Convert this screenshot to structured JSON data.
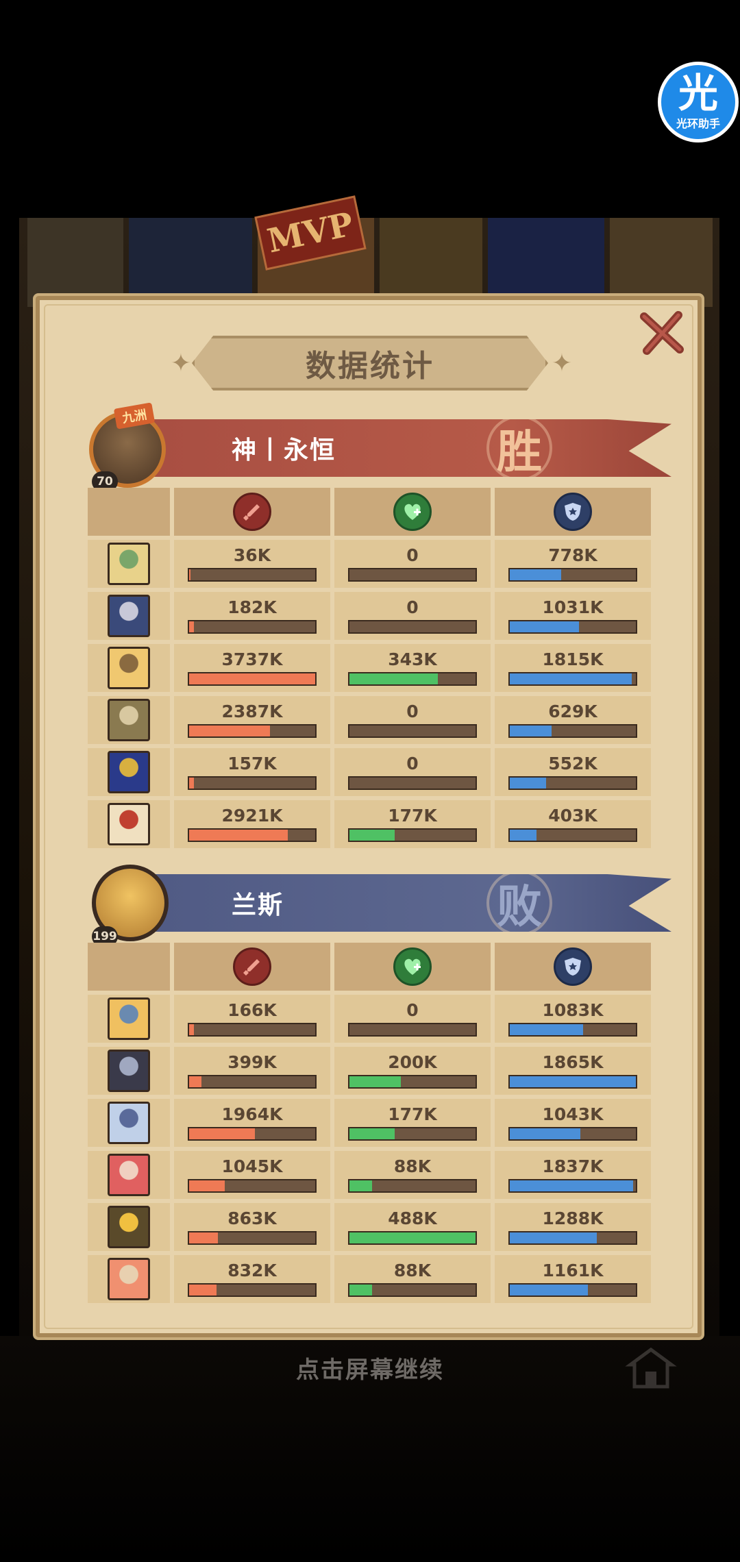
{
  "badge": {
    "glyph": "光",
    "label": "光环助手"
  },
  "mvp_label": "MVP",
  "panel": {
    "title": "数据统计",
    "close_glyph": "✕"
  },
  "footer": {
    "tap_to_continue": "点击屏幕继续"
  },
  "colors": {
    "damage_bar": "#ef7a55",
    "heal_bar": "#4fc164",
    "tank_bar": "#4b8fd8",
    "win_banner": "#a84e42",
    "lose_banner": "#505a84"
  },
  "teams": [
    {
      "name": "神丨永恒",
      "result": "胜",
      "level": "70",
      "rank_tag": "九洲",
      "columns": [
        "damage-icon",
        "heal-icon",
        "shield-icon"
      ],
      "heroes": [
        {
          "dmg": "36K",
          "dmg_pct": 0.01,
          "heal": "0",
          "heal_pct": 0,
          "tank": "778K",
          "tank_pct": 0.41
        },
        {
          "dmg": "182K",
          "dmg_pct": 0.04,
          "heal": "0",
          "heal_pct": 0,
          "tank": "1031K",
          "tank_pct": 0.55
        },
        {
          "dmg": "3737K",
          "dmg_pct": 1.0,
          "heal": "343K",
          "heal_pct": 0.7,
          "tank": "1815K",
          "tank_pct": 0.97
        },
        {
          "dmg": "2387K",
          "dmg_pct": 0.64,
          "heal": "0",
          "heal_pct": 0,
          "tank": "629K",
          "tank_pct": 0.33
        },
        {
          "dmg": "157K",
          "dmg_pct": 0.04,
          "heal": "0",
          "heal_pct": 0,
          "tank": "552K",
          "tank_pct": 0.29
        },
        {
          "dmg": "2921K",
          "dmg_pct": 0.78,
          "heal": "177K",
          "heal_pct": 0.36,
          "tank": "403K",
          "tank_pct": 0.21
        }
      ]
    },
    {
      "name": "兰斯",
      "result": "败",
      "level": "199",
      "columns": [
        "damage-icon",
        "heal-icon",
        "shield-icon"
      ],
      "heroes": [
        {
          "dmg": "166K",
          "dmg_pct": 0.04,
          "heal": "0",
          "heal_pct": 0,
          "tank": "1083K",
          "tank_pct": 0.58
        },
        {
          "dmg": "399K",
          "dmg_pct": 0.1,
          "heal": "200K",
          "heal_pct": 0.41,
          "tank": "1865K",
          "tank_pct": 1.0
        },
        {
          "dmg": "1964K",
          "dmg_pct": 0.52,
          "heal": "177K",
          "heal_pct": 0.36,
          "tank": "1043K",
          "tank_pct": 0.56
        },
        {
          "dmg": "1045K",
          "dmg_pct": 0.28,
          "heal": "88K",
          "heal_pct": 0.18,
          "tank": "1837K",
          "tank_pct": 0.98
        },
        {
          "dmg": "863K",
          "dmg_pct": 0.23,
          "heal": "488K",
          "heal_pct": 1.0,
          "tank": "1288K",
          "tank_pct": 0.69
        },
        {
          "dmg": "832K",
          "dmg_pct": 0.22,
          "heal": "88K",
          "heal_pct": 0.18,
          "tank": "1161K",
          "tank_pct": 0.62
        }
      ]
    }
  ]
}
